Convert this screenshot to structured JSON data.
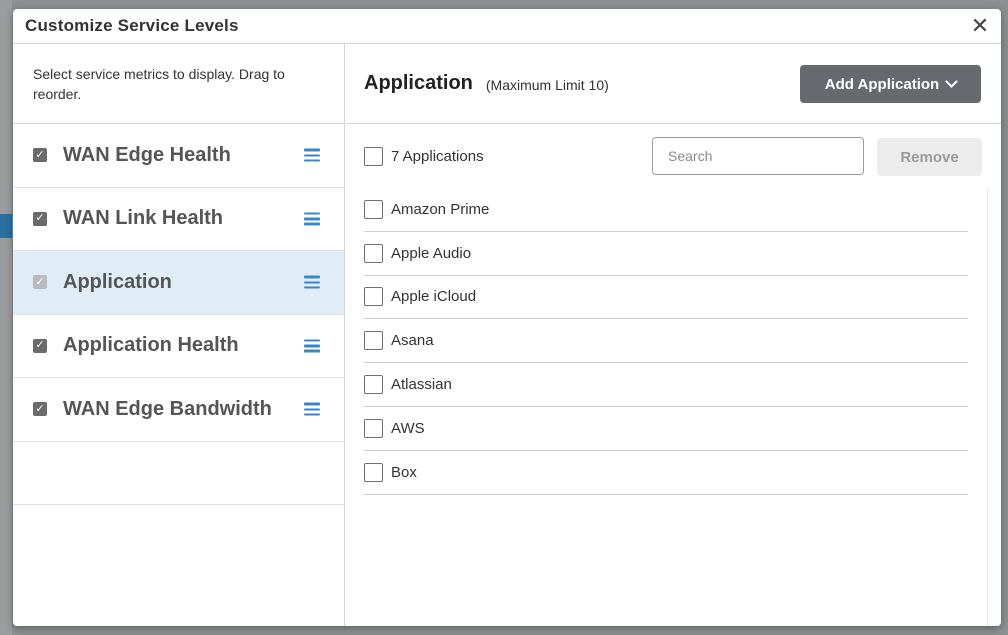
{
  "modal": {
    "title": "Customize Service Levels",
    "close_glyph": "✕"
  },
  "left": {
    "instructions": "Select service metrics to display. Drag to reorder.",
    "metrics": [
      {
        "label": "WAN Edge Health",
        "checked": true
      },
      {
        "label": "WAN Link Health",
        "checked": true
      },
      {
        "label": "Application",
        "checked": true,
        "active": true,
        "disabled": true
      },
      {
        "label": "Application Health",
        "checked": true
      },
      {
        "label": "WAN Edge Bandwidth",
        "checked": true
      }
    ]
  },
  "right": {
    "title": "Application",
    "limit": "(Maximum Limit 10)",
    "add_button": "Add Application",
    "select_all_label": "7 Applications",
    "search_placeholder": "Search",
    "remove_button": "Remove",
    "applications": [
      {
        "label": "Amazon Prime"
      },
      {
        "label": "Apple Audio"
      },
      {
        "label": "Apple iCloud"
      },
      {
        "label": "Asana"
      },
      {
        "label": "Atlassian"
      },
      {
        "label": "AWS"
      },
      {
        "label": "Box"
      }
    ]
  },
  "colors": {
    "accent_blue": "#3a86c8",
    "active_row_bg": "#e1edf6",
    "primary_button": "#666a6e"
  },
  "icons": {
    "close": "close-icon",
    "drag": "drag-handle-icon",
    "dropdown": "chevron-down-icon",
    "check": "checkmark-icon"
  }
}
